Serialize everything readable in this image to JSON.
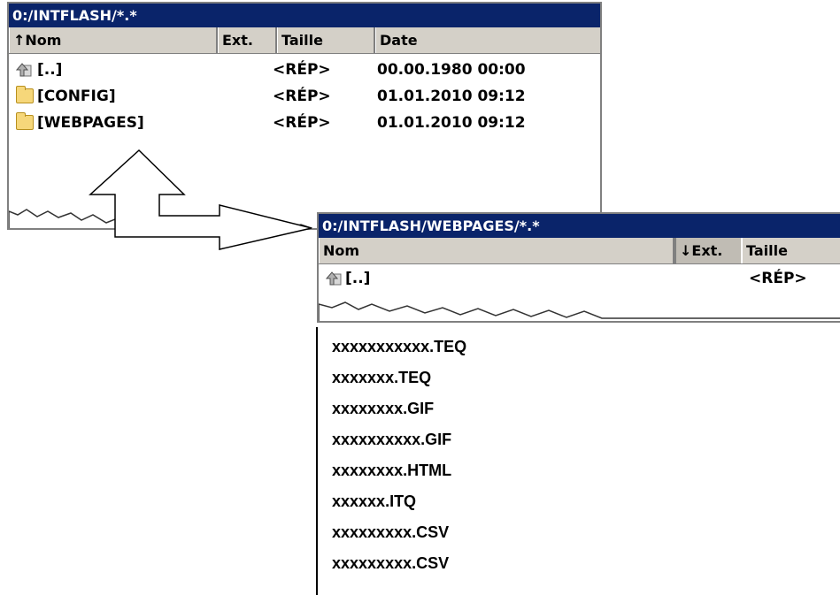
{
  "panel1": {
    "title": "0:/INTFLASH/*.*",
    "columns": [
      "↑Nom",
      "Ext.",
      "Taille",
      "Date"
    ],
    "rows": [
      {
        "icon": "up-folder-icon",
        "name": "[..]",
        "size": "<RÉP>",
        "date": "00.00.1980 00:00"
      },
      {
        "icon": "folder-icon",
        "name": "[CONFIG]",
        "size": "<RÉP>",
        "date": "01.01.2010 09:12"
      },
      {
        "icon": "folder-icon",
        "name": "[WEBPAGES]",
        "size": "<RÉP>",
        "date": "01.01.2010 09:12"
      }
    ]
  },
  "panel2": {
    "title": "0:/INTFLASH/WEBPAGES/*.*",
    "columns": [
      "Nom",
      "↓Ext.",
      "Taille"
    ],
    "rows": [
      {
        "icon": "up-folder-icon",
        "name": "[..]",
        "size": "<RÉP>"
      }
    ]
  },
  "files": [
    "xxxxxxxxxxx.TEQ",
    "xxxxxxx.TEQ",
    "xxxxxxxx.GIF",
    "xxxxxxxxxx.GIF",
    "xxxxxxxx.HTML",
    "xxxxxx.ITQ",
    "xxxxxxxxx.CSV",
    "xxxxxxxxx.CSV"
  ],
  "colors": {
    "titlebar": "#0a246a",
    "header": "#d4d0c8",
    "folder": "#f6d77a"
  }
}
